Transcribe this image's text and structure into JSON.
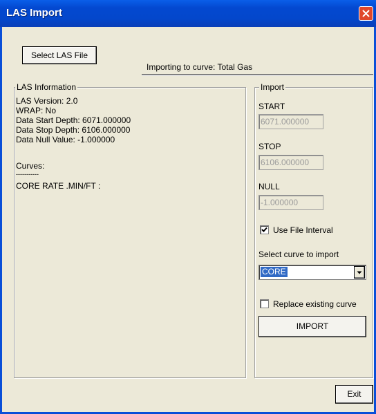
{
  "window": {
    "title": "LAS Import"
  },
  "toolbar": {
    "select_file_label": "Select LAS File",
    "import_status": "Importing to curve: Total Gas"
  },
  "las_info": {
    "group_title": "LAS Information",
    "lines": [
      "LAS Version: 2.0",
      "WRAP: No",
      "Data Start Depth: 6071.000000",
      "Data Stop Depth: 6106.000000",
      "Data Null Value: -1.000000"
    ],
    "curves_label": "Curves:",
    "curves_separator": "-----------",
    "curve_entry": "CORE RATE .MIN/FT :"
  },
  "import": {
    "group_title": "Import",
    "start_label": "START",
    "start_value": "6071.000000",
    "stop_label": "STOP",
    "stop_value": "6106.000000",
    "null_label": "NULL",
    "null_value": "-1.000000",
    "use_file_interval_label": "Use File Interval",
    "use_file_interval_checked": true,
    "select_curve_label": "Select curve to import",
    "selected_curve": "CORE",
    "replace_label": "Replace existing curve",
    "replace_checked": false,
    "import_button": "IMPORT"
  },
  "footer": {
    "exit_button": "Exit"
  },
  "colors": {
    "titlebar": "#0348d0",
    "close": "#e0472b",
    "selection": "#316ac5",
    "background": "#ece9d8"
  }
}
